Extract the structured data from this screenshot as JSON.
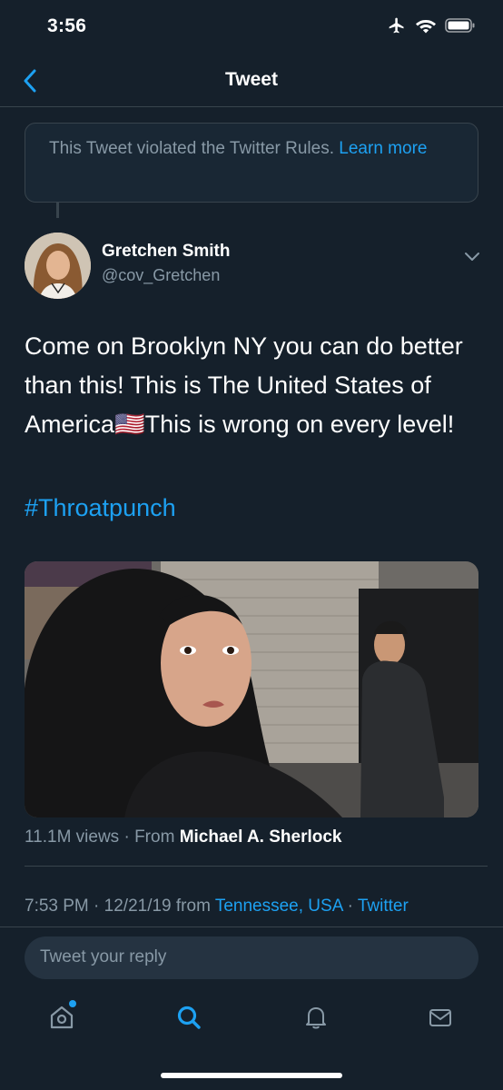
{
  "status_bar": {
    "time": "3:56"
  },
  "nav": {
    "title": "Tweet"
  },
  "notice": {
    "text": "This Tweet violated the Twitter Rules.",
    "link": "Learn more"
  },
  "author": {
    "name": "Gretchen Smith",
    "handle": "@cov_Gretchen"
  },
  "tweet": {
    "text_before_flag": "Come on Brooklyn NY you can do better than this! This is The United States of America",
    "flag": "🇺🇸",
    "text_after_flag": "This is wrong on every level!",
    "hashtag": "#Throatpunch"
  },
  "video": {
    "views": "11.1M views",
    "separator": " · From ",
    "source": "Michael A. Sherlock"
  },
  "timestamp": {
    "time": "7:53 PM",
    "sep1": " · ",
    "date": "12/21/19",
    "from_label": " from ",
    "location": "Tennessee, USA",
    "sep2": " · ",
    "client": "Twitter"
  },
  "reply": {
    "placeholder": "Tweet your reply"
  },
  "tabs": [
    {
      "icon": "home-icon",
      "active": false,
      "has_dot": true
    },
    {
      "icon": "search-icon",
      "active": true
    },
    {
      "icon": "notifications-icon",
      "active": false
    },
    {
      "icon": "messages-icon",
      "active": false
    }
  ],
  "colors": {
    "background": "#15202b",
    "accent": "#1da1f2",
    "secondary_text": "#8899a6",
    "border": "#38444d"
  }
}
